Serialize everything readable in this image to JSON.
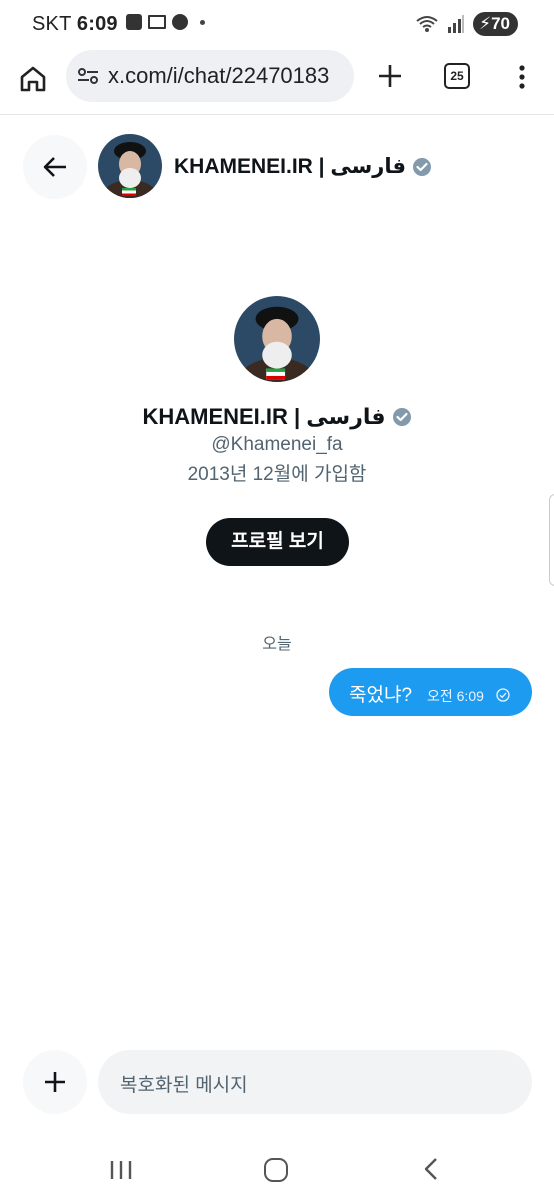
{
  "status_bar": {
    "carrier": "SKT",
    "time": "6:09",
    "battery": "70",
    "notification_icons": [
      "mail-icon",
      "gmail-icon",
      "talk-icon"
    ]
  },
  "browser": {
    "url": "x.com/i/chat/22470183",
    "tab_count": "25"
  },
  "chat_header": {
    "name": "KHAMENEI.IR | فارسی"
  },
  "profile": {
    "name": "KHAMENEI.IR | فارسی",
    "handle": "@Khamenei_fa",
    "joined": "2013년 12월에 가입함",
    "view_profile_label": "프로필 보기"
  },
  "messages": {
    "date_divider": "오늘",
    "items": [
      {
        "text": "죽었냐?",
        "time": "오전 6:09",
        "direction": "outgoing",
        "status": "sent"
      }
    ]
  },
  "composer": {
    "placeholder": "복호화된 메시지"
  },
  "colors": {
    "accent": "#1d9bf0",
    "primary_text": "#0f1419",
    "secondary_text": "#536471",
    "verified": "#829aab"
  }
}
